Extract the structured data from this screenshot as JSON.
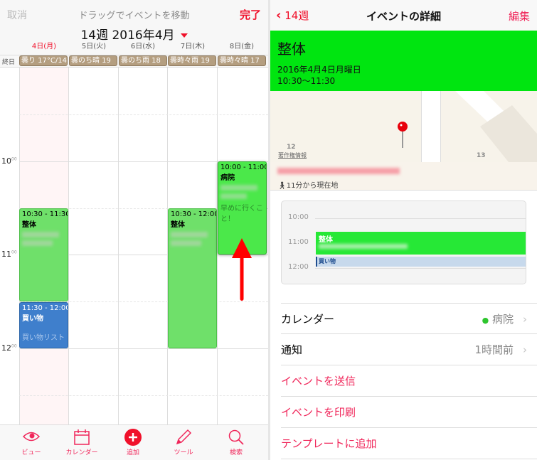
{
  "left": {
    "cancel": "取消",
    "title": "ドラッグでイベントを移動",
    "done": "完了",
    "week": "14週  2016年4月",
    "days": [
      "4日(月)",
      "5日(火)",
      "6日(水)",
      "7日(木)",
      "8日(金)"
    ],
    "allday_label": "終日",
    "weather": [
      "曇り 17°C/14",
      "曇のち晴 19",
      "曇のち雨 18",
      "曇時々雨 19",
      "曇時々晴 17"
    ],
    "hours": [
      "10",
      "11",
      "12"
    ],
    "minutes": "00",
    "events": [
      {
        "time": "10:30 - 11:30",
        "title": "整体",
        "day": "月",
        "color": "#6fe06a"
      },
      {
        "time": "11:30 - 12:00",
        "title": "買い物",
        "note": "買い物リスト",
        "day": "月",
        "color": "#3f7fcc"
      },
      {
        "time": "10:30 - 12:00",
        "title": "整体",
        "day": "木",
        "color": "#6fe06a"
      },
      {
        "time": "10:00 - 11:00",
        "title": "病院",
        "note": "早めに行くこと！",
        "day": "金",
        "color": "#4be84a"
      }
    ],
    "tabs": [
      {
        "label": "ビュー",
        "icon": "eye-icon"
      },
      {
        "label": "カレンダー",
        "icon": "calendar-icon"
      },
      {
        "label": "追加",
        "icon": "plus-circle-icon"
      },
      {
        "label": "ツール",
        "icon": "pencil-icon"
      },
      {
        "label": "検索",
        "icon": "search-icon"
      }
    ],
    "accent": "#f0102a"
  },
  "right": {
    "back": "14週",
    "title": "イベントの詳細",
    "edit": "編集",
    "event": {
      "title": "整体",
      "date": "2016年4月4日月曜日",
      "time": "10:30〜11:30",
      "color": "#00e510"
    },
    "map": {
      "label12": "12",
      "label13": "13",
      "copyright": "著作権情報"
    },
    "travel": "11分から現在地",
    "mini": {
      "hours": [
        "10:00",
        "11:00",
        "12:00"
      ],
      "event1": "整体",
      "event2": "買い物"
    },
    "rows": [
      {
        "label": "カレンダー",
        "value": "病院"
      },
      {
        "label": "通知",
        "value": "1時間前"
      }
    ],
    "actions": [
      "イベントを送信",
      "イベントを印刷",
      "テンプレートに追加"
    ]
  }
}
